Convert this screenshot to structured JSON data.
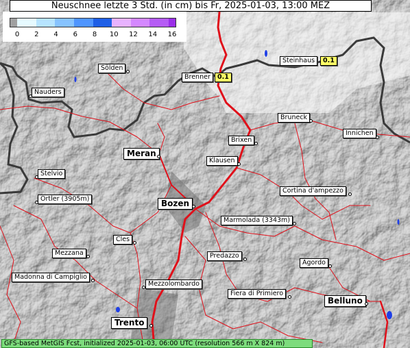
{
  "title": "Neuschnee letzte 3 Std. (in cm) bis Fr, 2025-01-03, 13:00 MEZ",
  "legend": {
    "ticks": [
      "0",
      "2",
      "4",
      "6",
      "8",
      "10",
      "12",
      "14",
      "16"
    ],
    "colors": [
      "#a0a0a0",
      "#e6faff",
      "#b7e4ff",
      "#87c3ff",
      "#4f95ff",
      "#1f5fe6",
      "#e8b3ff",
      "#d488ff",
      "#b55cf5",
      "#9a2fe8"
    ]
  },
  "places": {
    "soelden": "Sölden",
    "nauders": "Nauders",
    "brenner": "Brenner",
    "steinhaus": "Steinhaus",
    "bruneck": "Bruneck",
    "innichen": "Innichen",
    "meran": "Meran",
    "brixen": "Brixen",
    "klausen": "Klausen",
    "stelvio": "Stelvio",
    "ortler": "Ortler (3905m)",
    "cortina": "Cortina d'ampezzo",
    "bozen": "Bozen",
    "marmolada": "Marmolada (3343m)",
    "cles": "Cles",
    "mezzana": "Mezzana",
    "predazzo": "Predazzo",
    "agordo": "Agordo",
    "madonna": "Madonna di Campiglio",
    "mezzolombardo": "Mezzolombardo",
    "fiera": "Fiera di Primiero",
    "belluno": "Belluno",
    "trento": "Trento"
  },
  "values": {
    "brenner": "0.1",
    "steinhaus": "0.1"
  },
  "footer": "GFS-based MetGIS Fcst, initialized 2025-01-03, 06:00 UTC  (resolution 566 m X 824 m)"
}
